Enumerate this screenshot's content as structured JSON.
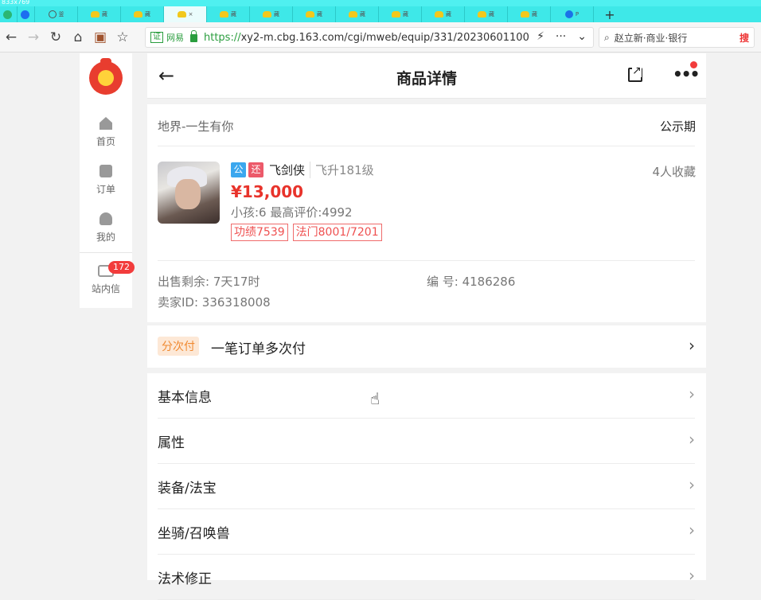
{
  "browser": {
    "tiny_label": "833x769",
    "tabs": [
      {
        "label": "",
        "icon": "wechat-icon"
      },
      {
        "label": "",
        "icon": "baidu-icon"
      },
      {
        "label": "釜",
        "icon": "globe-icon"
      },
      {
        "label": "藏",
        "icon": "cbg-icon"
      },
      {
        "label": "藏",
        "icon": "cbg-icon"
      },
      {
        "label": "×",
        "icon": "cbg-icon",
        "active": true
      },
      {
        "label": "藏",
        "icon": "cbg-icon"
      },
      {
        "label": "藏",
        "icon": "cbg-icon"
      },
      {
        "label": "藏",
        "icon": "cbg-icon"
      },
      {
        "label": "藏",
        "icon": "cbg-icon"
      },
      {
        "label": "藏",
        "icon": "cbg-icon"
      },
      {
        "label": "藏",
        "icon": "cbg-icon"
      },
      {
        "label": "藏",
        "icon": "cbg-icon"
      },
      {
        "label": "藏",
        "icon": "cbg-icon"
      },
      {
        "label": "P",
        "icon": "edge-icon"
      }
    ],
    "new_tab": "+",
    "cert_label": "证",
    "site_name": "网易",
    "url_scheme": "https://",
    "url_rest": "xy2-m.cbg.163.com/cgi/mweb/equip/331/20230601100",
    "search_text": "赵立新·商业·银行",
    "search_hot": "搜"
  },
  "sidebar": {
    "items": [
      {
        "label": "首页",
        "icon": "home-icon"
      },
      {
        "label": "订单",
        "icon": "order-icon"
      },
      {
        "label": "我的",
        "icon": "user-icon"
      },
      {
        "label": "站内信",
        "icon": "mail-icon"
      }
    ],
    "mail_badge": "172"
  },
  "header": {
    "title": "商品详情"
  },
  "item": {
    "server": "地界-一生有你",
    "status": "公示期",
    "tag_gong": "公",
    "tag_huan": "还",
    "role": "飞剑侠",
    "level": "飞升181级",
    "favorites": "4人收藏",
    "price": "¥13,000",
    "line3": "小孩:6 最高评价:4992",
    "chips": [
      "功绩7539",
      "法门8001/7201"
    ],
    "remain": "出售剩余: 7天17时",
    "number": "编 号: 4186286",
    "seller": "卖家ID: 336318008"
  },
  "installment": {
    "tag": "分次付",
    "text": "一笔订单多次付",
    "arrow": "›"
  },
  "sections": [
    {
      "label": "基本信息"
    },
    {
      "label": "属性"
    },
    {
      "label": "装备/法宝"
    },
    {
      "label": "坐骑/召唤兽"
    },
    {
      "label": "法术修正"
    }
  ],
  "chevron": "›"
}
